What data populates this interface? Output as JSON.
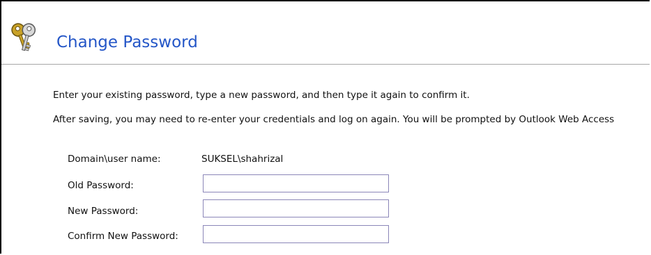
{
  "header": {
    "icon": "keys-icon",
    "title": "Change Password",
    "title_color": "#2456c7"
  },
  "instructions": {
    "line1": "Enter your existing password, type a new password, and then type it again to confirm it.",
    "line2": "After saving, you may need to re-enter your credentials and log on again. You will be prompted by Outlook Web Access"
  },
  "form": {
    "domain_label": "Domain\\user name:",
    "domain_value": "SUKSEL\\shahrizal",
    "old_password_label": "Old Password:",
    "old_password_value": "",
    "new_password_label": "New Password:",
    "new_password_value": "",
    "confirm_password_label": "Confirm New Password:",
    "confirm_password_value": ""
  }
}
